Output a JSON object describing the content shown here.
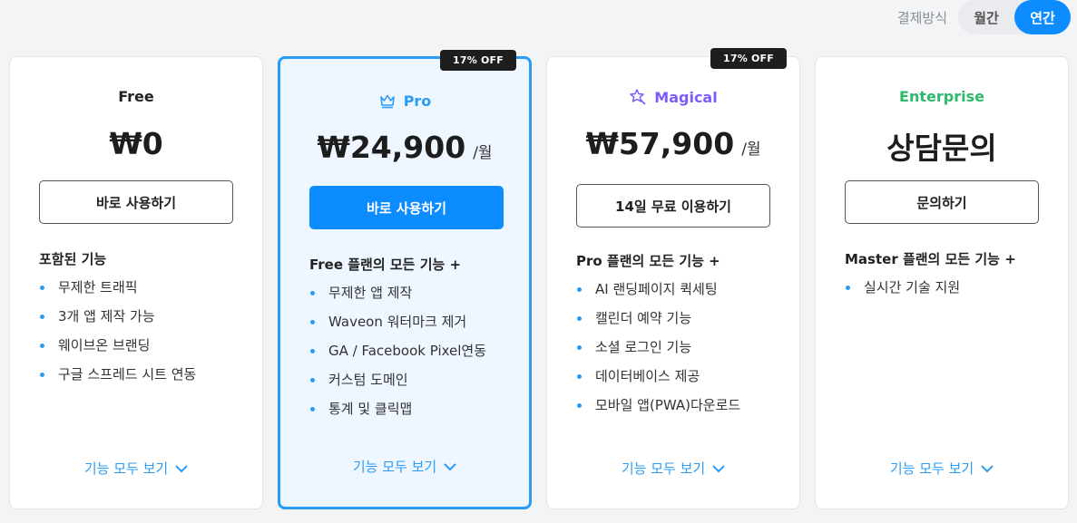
{
  "billing": {
    "label": "결제방식",
    "monthly": "월간",
    "annual": "연간",
    "selected": "annual"
  },
  "colors": {
    "accent": "#0d8cff",
    "pro": "#2b9cf5",
    "magical": "#7c5cff",
    "enterprise": "#2fb86b"
  },
  "plans": [
    {
      "name": "Free",
      "icon": "",
      "price": "₩0",
      "unit": "",
      "badge": "",
      "cta": "바로 사용하기",
      "feature_head": "포함된 기능",
      "features": [
        "무제한 트래픽",
        "3개 앱 제작 가능",
        "웨이브온 브랜딩",
        "구글 스프레드 시트 연동"
      ],
      "more": "기능 모두 보기"
    },
    {
      "name": "Pro",
      "icon": "crown-icon",
      "price": "₩24,900",
      "unit": "/월",
      "badge": "17% OFF",
      "cta": "바로 사용하기",
      "feature_head": "Free 플랜의 모든 기능 +",
      "features": [
        "무제한 앱 제작",
        "Waveon 워터마크 제거",
        "GA / Facebook Pixel연동",
        "커스텀 도메인",
        "통계 및 클릭맵"
      ],
      "more": "기능 모두 보기"
    },
    {
      "name": "Magical",
      "icon": "magic-wand-icon",
      "price": "₩57,900",
      "unit": "/월",
      "badge": "17% OFF",
      "cta": "14일 무료 이용하기",
      "feature_head": "Pro 플랜의 모든 기능 +",
      "features": [
        "AI 랜딩페이지 퀵세팅",
        "캘린더 예약 기능",
        "소셜 로그인 기능",
        "데이터베이스 제공",
        "모바일 앱(PWA)다운로드"
      ],
      "more": "기능 모두 보기"
    },
    {
      "name": "Enterprise",
      "icon": "",
      "price": "상담문의",
      "unit": "",
      "badge": "",
      "cta": "문의하기",
      "feature_head": "Master 플랜의 모든 기능 +",
      "features": [
        "실시간 기술 지원"
      ],
      "more": "기능 모두 보기"
    }
  ]
}
